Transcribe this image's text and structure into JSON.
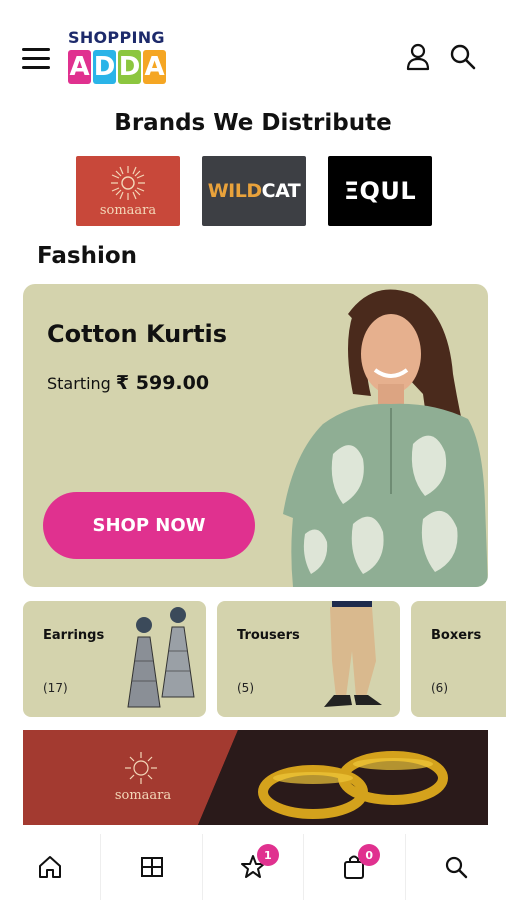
{
  "header": {
    "logo_top": "SHOPPING",
    "logo_letters": [
      "A",
      "D",
      "D",
      "A"
    ],
    "logo_colors": [
      "#e0318f",
      "#2ab4e8",
      "#8cc63f",
      "#f5a623"
    ]
  },
  "brands": {
    "title": "Brands We Distribute",
    "items": [
      {
        "name": "somaara"
      },
      {
        "name_part1": "WILD",
        "name_part2": "CAT"
      },
      {
        "name": "ΞQUL"
      }
    ]
  },
  "fashion": {
    "title": "Fashion",
    "hero": {
      "title": "Cotton Kurtis",
      "price_prefix": "Starting ",
      "price": "₹ 599.00",
      "button": "SHOP NOW"
    },
    "categories": [
      {
        "name": "Earrings",
        "count": "(17)"
      },
      {
        "name": "Trousers",
        "count": "(5)"
      },
      {
        "name": "Boxers",
        "count": "(6)"
      }
    ]
  },
  "promo": {
    "brand": "somaara"
  },
  "bottom_nav": {
    "items": [
      {
        "icon": "home-icon"
      },
      {
        "icon": "grid-icon"
      },
      {
        "icon": "star-icon",
        "badge": "1"
      },
      {
        "icon": "bag-icon",
        "badge": "0"
      },
      {
        "icon": "search-icon"
      }
    ]
  },
  "colors": {
    "accent": "#e0318f",
    "card_bg": "#d4d3ad"
  }
}
